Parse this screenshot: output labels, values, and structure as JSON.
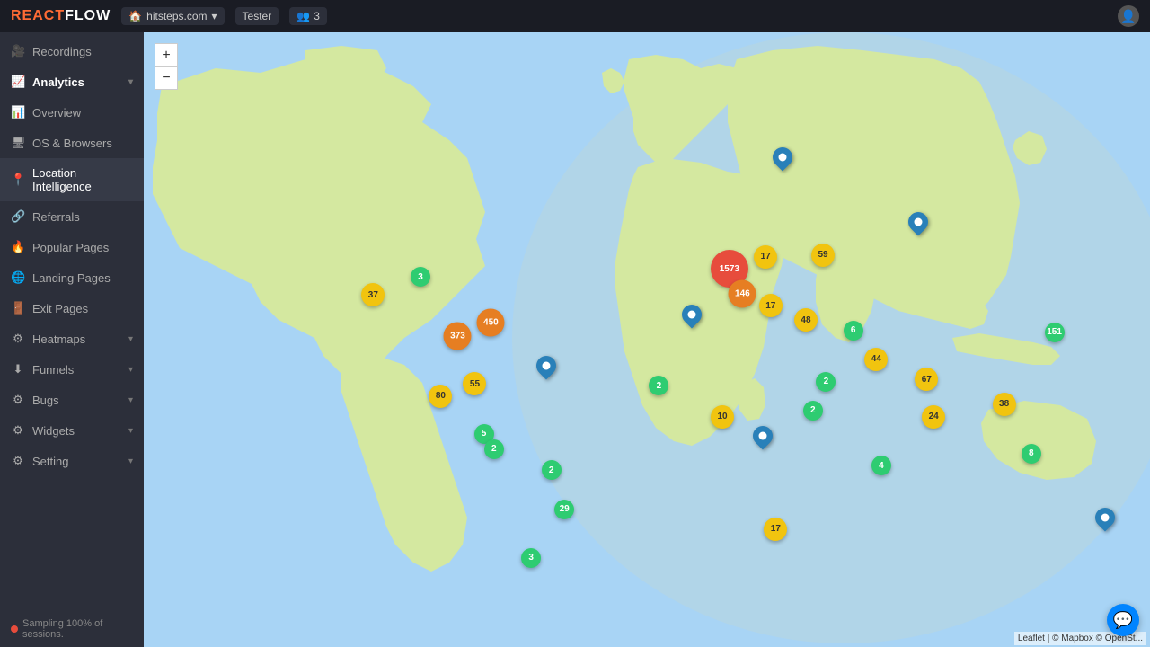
{
  "topbar": {
    "logo_react": "REACT",
    "logo_flow": "FLOW",
    "site": "hitsteps.com",
    "badge": "Tester",
    "users_icon": "👥",
    "users_count": "3"
  },
  "sidebar": {
    "recordings_label": "Recordings",
    "analytics_label": "Analytics",
    "items": [
      {
        "id": "overview",
        "label": "Overview",
        "icon": "📊"
      },
      {
        "id": "os-browsers",
        "label": "OS & Browsers",
        "icon": "🖥"
      },
      {
        "id": "location",
        "label": "Location Intelligence",
        "icon": "📍",
        "active": true
      },
      {
        "id": "referrals",
        "label": "Referrals",
        "icon": "🔗"
      },
      {
        "id": "popular-pages",
        "label": "Popular Pages",
        "icon": "🔥"
      },
      {
        "id": "landing-pages",
        "label": "Landing Pages",
        "icon": "🌐"
      },
      {
        "id": "exit-pages",
        "label": "Exit Pages",
        "icon": "🚪"
      },
      {
        "id": "heatmaps",
        "label": "Heatmaps",
        "icon": "⚙",
        "has_chevron": true
      },
      {
        "id": "funnels",
        "label": "Funnels",
        "icon": "⬇",
        "has_chevron": true
      },
      {
        "id": "bugs",
        "label": "Bugs",
        "icon": "⚙",
        "has_chevron": true
      },
      {
        "id": "widgets",
        "label": "Widgets",
        "icon": "⚙",
        "has_chevron": true
      },
      {
        "id": "setting",
        "label": "Setting",
        "icon": "⚙",
        "has_chevron": true
      }
    ],
    "sampling_text": "Sampling 100% of sessions."
  },
  "map": {
    "zoom_in": "+",
    "zoom_out": "−",
    "attribution": "Leaflet | © Mapbox © OpenSt...",
    "markers": [
      {
        "id": "m1",
        "type": "green",
        "value": "3",
        "x": 27.5,
        "y": 39.8
      },
      {
        "id": "m2",
        "type": "yellow",
        "value": "37",
        "x": 22.8,
        "y": 42.7
      },
      {
        "id": "m3",
        "type": "orange",
        "value": "450",
        "x": 34.5,
        "y": 47.2
      },
      {
        "id": "m4",
        "type": "orange",
        "value": "373",
        "x": 31.2,
        "y": 49.4
      },
      {
        "id": "m5",
        "type": "yellow",
        "value": "55",
        "x": 32.9,
        "y": 57.2
      },
      {
        "id": "m6",
        "type": "yellow",
        "value": "80",
        "x": 29.5,
        "y": 59.2
      },
      {
        "id": "m7",
        "type": "green",
        "value": "5",
        "x": 33.8,
        "y": 65.3
      },
      {
        "id": "m8",
        "type": "green",
        "value": "2",
        "x": 34.8,
        "y": 67.8
      },
      {
        "id": "m9",
        "type": "green",
        "value": "29",
        "x": 41.8,
        "y": 77.6
      },
      {
        "id": "m10",
        "type": "green",
        "value": "2",
        "x": 40.5,
        "y": 71.2
      },
      {
        "id": "m11",
        "type": "green",
        "value": "3",
        "x": 38.5,
        "y": 85.5
      },
      {
        "id": "m12",
        "type": "red",
        "value": "1573",
        "x": 58.2,
        "y": 38.5
      },
      {
        "id": "m13",
        "type": "orange",
        "value": "146",
        "x": 59.5,
        "y": 42.6
      },
      {
        "id": "m14",
        "type": "yellow",
        "value": "17",
        "x": 61.8,
        "y": 36.5
      },
      {
        "id": "m15",
        "type": "yellow",
        "value": "59",
        "x": 67.5,
        "y": 36.2
      },
      {
        "id": "m16",
        "type": "yellow",
        "value": "17",
        "x": 62.3,
        "y": 44.5
      },
      {
        "id": "m17",
        "type": "yellow",
        "value": "48",
        "x": 65.8,
        "y": 46.8
      },
      {
        "id": "m18",
        "type": "green",
        "value": "6",
        "x": 70.5,
        "y": 48.5
      },
      {
        "id": "m19",
        "type": "yellow",
        "value": "44",
        "x": 72.8,
        "y": 53.2
      },
      {
        "id": "m20",
        "type": "yellow",
        "value": "24",
        "x": 78.5,
        "y": 62.5
      },
      {
        "id": "m21",
        "type": "yellow",
        "value": "67",
        "x": 77.8,
        "y": 56.5
      },
      {
        "id": "m22",
        "type": "green",
        "value": "4",
        "x": 73.3,
        "y": 70.5
      },
      {
        "id": "m23",
        "type": "green",
        "value": "2",
        "x": 67.8,
        "y": 56.8
      },
      {
        "id": "m24",
        "type": "green",
        "value": "2",
        "x": 66.5,
        "y": 61.5
      },
      {
        "id": "m25",
        "type": "yellow",
        "value": "10",
        "x": 57.5,
        "y": 62.5
      },
      {
        "id": "m26",
        "type": "green",
        "value": "2",
        "x": 51.2,
        "y": 57.5
      },
      {
        "id": "m27",
        "type": "green",
        "value": "8",
        "x": 88.2,
        "y": 68.5
      },
      {
        "id": "m28",
        "type": "yellow",
        "value": "38",
        "x": 85.5,
        "y": 60.5
      },
      {
        "id": "m29",
        "type": "green",
        "value": "151",
        "x": 90.5,
        "y": 48.8
      },
      {
        "id": "m30",
        "type": "yellow",
        "value": "17",
        "x": 62.8,
        "y": 80.8
      },
      {
        "id": "p1",
        "type": "pin",
        "x": 63.5,
        "y": 22.0
      },
      {
        "id": "p2",
        "type": "pin",
        "x": 54.5,
        "y": 47.5
      },
      {
        "id": "p3",
        "type": "pin",
        "x": 40.0,
        "y": 55.8
      },
      {
        "id": "p4",
        "type": "pin",
        "x": 61.5,
        "y": 67.2
      },
      {
        "id": "p5",
        "type": "pin",
        "x": 77.0,
        "y": 32.5
      },
      {
        "id": "p6",
        "type": "pin-right",
        "x": 95.5,
        "y": 80.5
      }
    ]
  }
}
